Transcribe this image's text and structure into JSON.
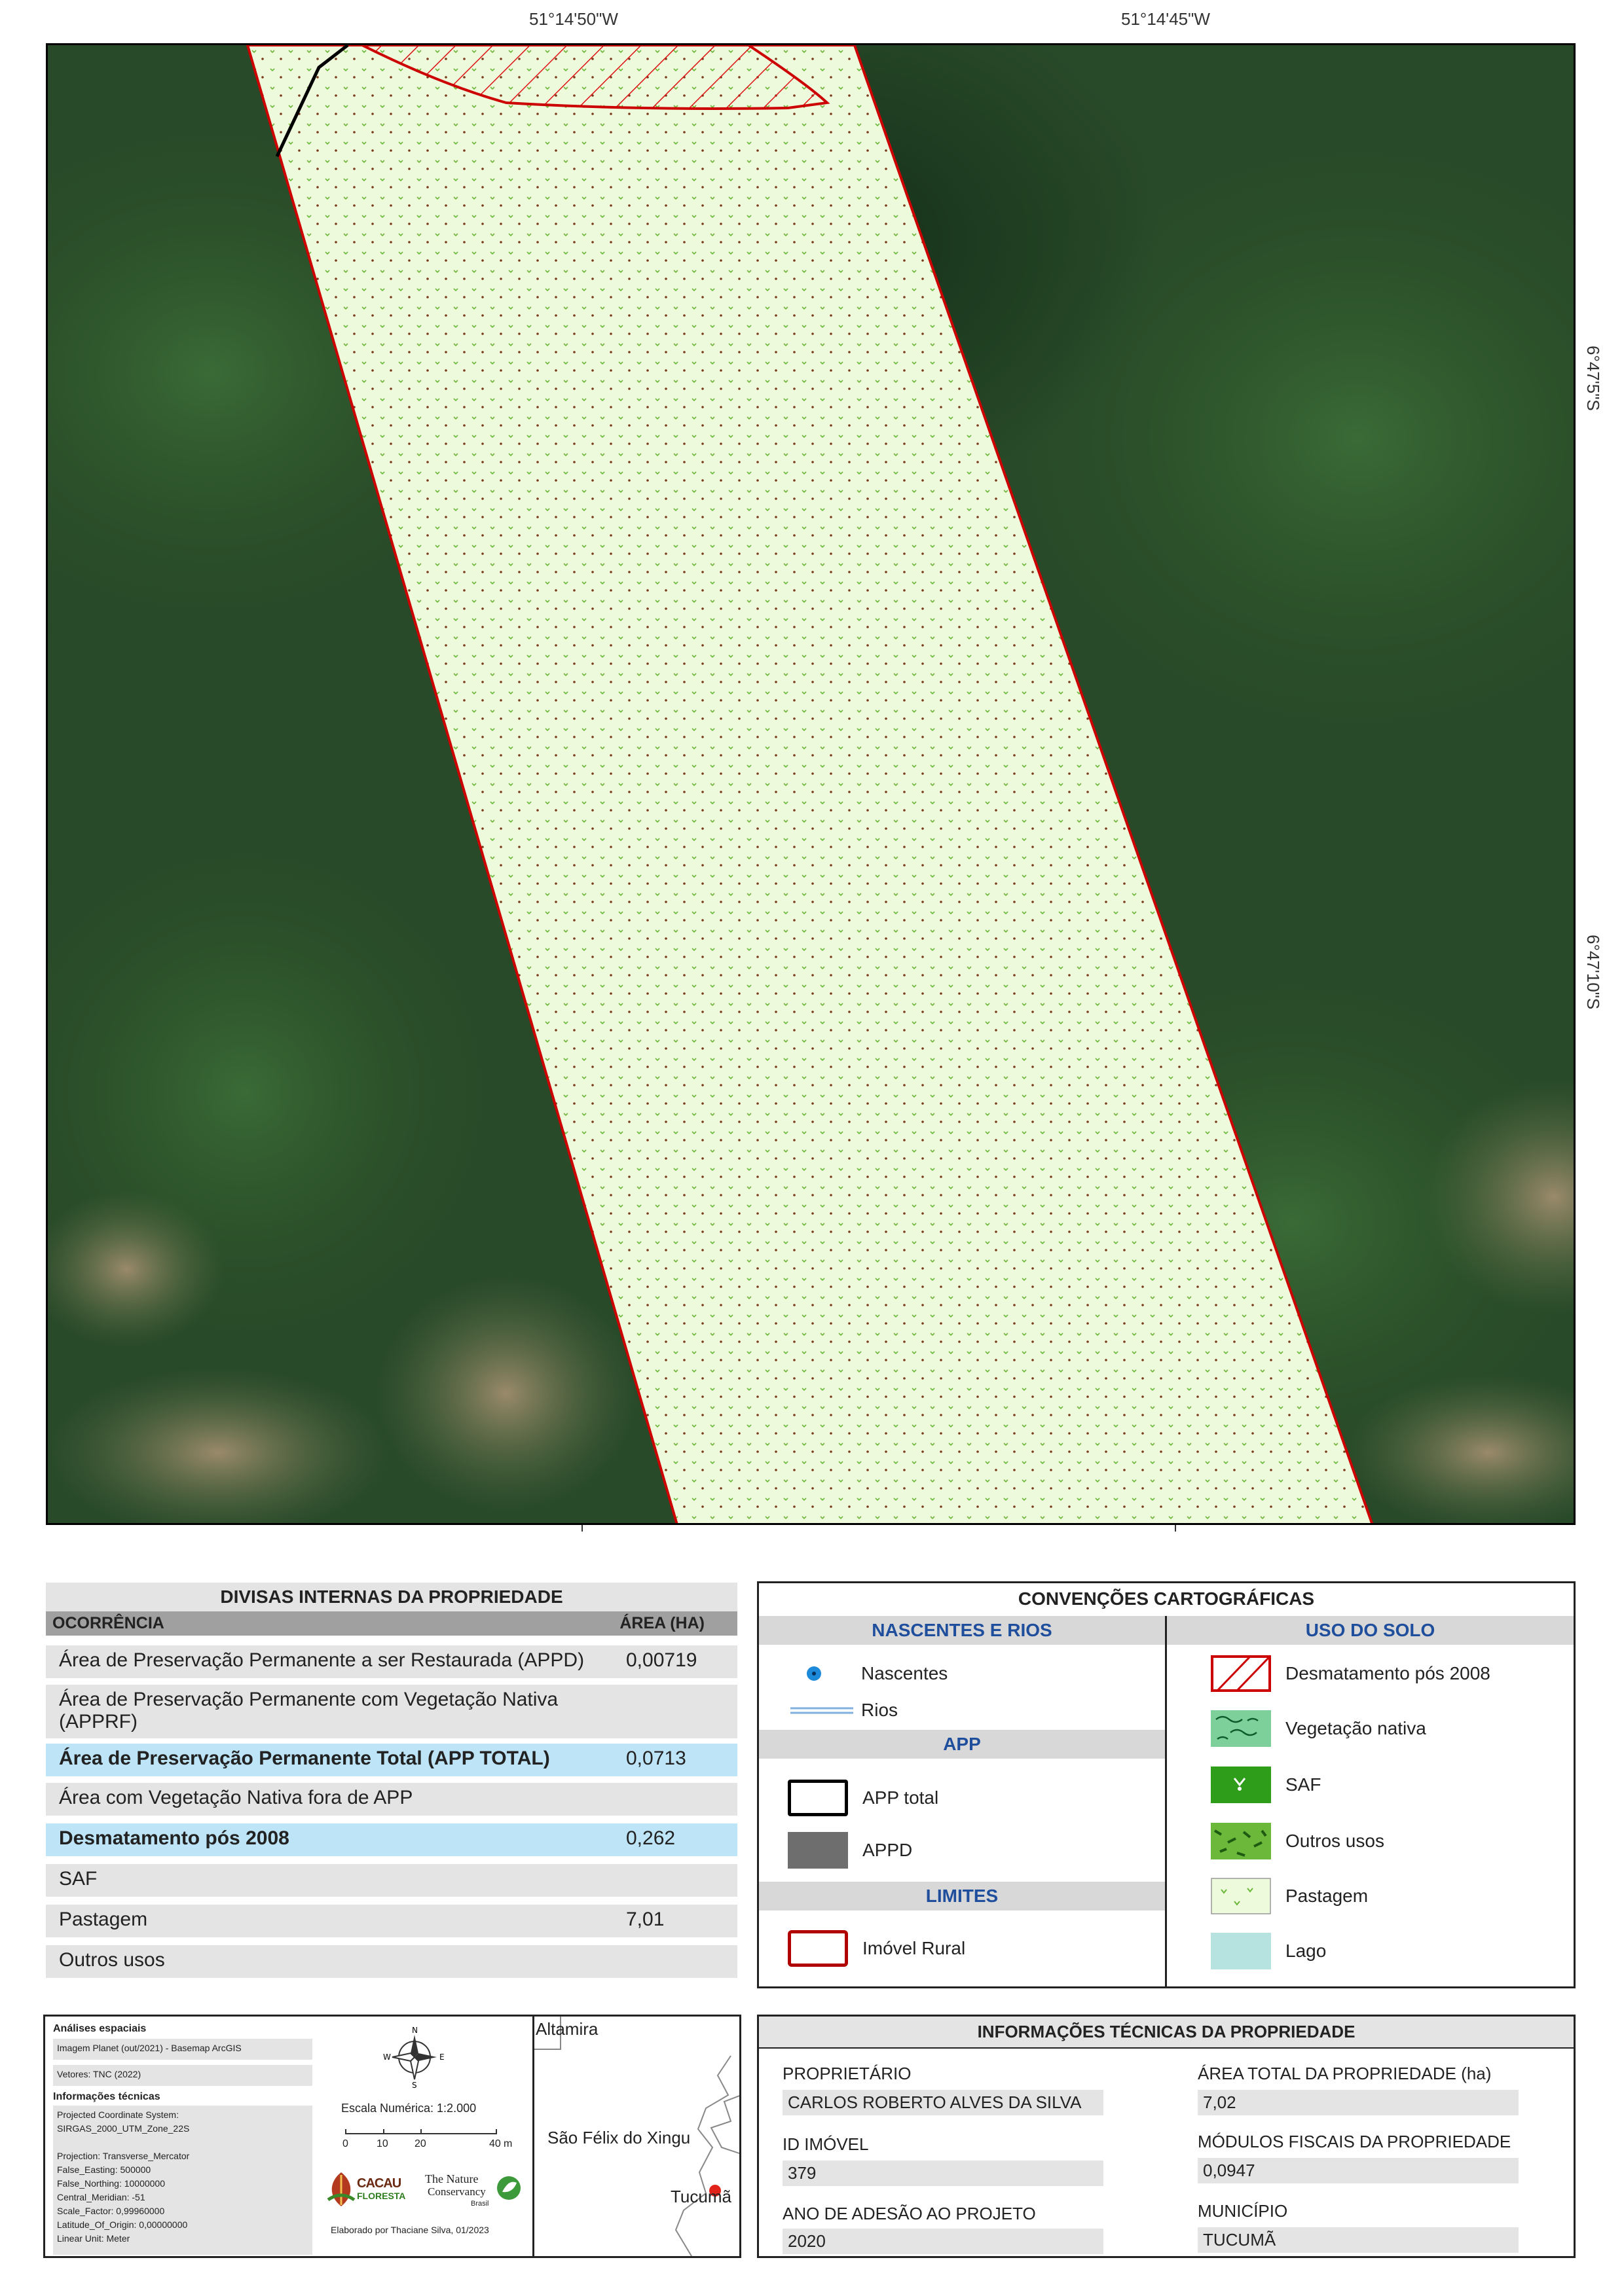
{
  "coordinates": {
    "top": [
      "51°14'50\"W",
      "51°14'45\"W"
    ],
    "right": [
      "6°47'5\"S",
      "6°47'10\"S"
    ]
  },
  "internal_divisions": {
    "title": "DIVISAS INTERNAS DA PROPRIEDADE",
    "col_occurrence": "OCORRÊNCIA",
    "col_area": "ÁREA (HA)",
    "rows": [
      {
        "label": "Área de Preservação Permanente a ser Restaurada (APPD)",
        "value": "0,00719"
      },
      {
        "label": "Área de Preservação Permanente com Vegetação Nativa (APPRF)",
        "value": ""
      },
      {
        "label": "Área de Preservação Permanente Total (APP TOTAL)",
        "value": "0,0713"
      },
      {
        "label": "Área com Vegetação Nativa fora de APP",
        "value": ""
      },
      {
        "label": "Desmatamento pós 2008",
        "value": "0,262"
      },
      {
        "label": "SAF",
        "value": ""
      },
      {
        "label": "Pastagem",
        "value": "7,01"
      },
      {
        "label": "Outros usos",
        "value": ""
      }
    ]
  },
  "legend": {
    "title": "CONVENÇÕES CARTOGRÁFICAS",
    "springs_rivers": {
      "heading": "NASCENTES E RIOS",
      "items": [
        "Nascentes",
        "Rios"
      ]
    },
    "app": {
      "heading": "APP",
      "items": [
        "APP total",
        "APPD"
      ]
    },
    "limits": {
      "heading": "LIMITES",
      "items": [
        "Imóvel Rural"
      ]
    },
    "land_use": {
      "heading": "USO DO SOLO",
      "items": [
        "Desmatamento pós 2008",
        "Vegetação nativa",
        "SAF",
        "Outros usos",
        "Pastagem",
        "Lago"
      ]
    },
    "colors": {
      "limit": "#cc0000",
      "appd": "#6e6e6e",
      "pasture": "#eefadc",
      "saf": "#2e9e1a",
      "native": "#7ed09a",
      "other": "#6cb83a",
      "lake": "#b6e2e0"
    }
  },
  "spatial": {
    "analysis_title": "Análises espaciais",
    "image_source": "Imagem Planet (out/2021) - Basemap ArcGIS",
    "vectors": "Vetores: TNC (2022)",
    "tech_title": "Informações técnicas",
    "tech_lines": [
      "Projected Coordinate System:",
      "SIRGAS_2000_UTM_Zone_22S",
      "",
      "Projection: Transverse_Mercator",
      "False_Easting: 500000",
      "False_Northing: 10000000",
      "Central_Meridian: -51",
      "Scale_Factor: 0,99960000",
      "Latitude_Of_Origin: 0,00000000",
      "Linear Unit: Meter"
    ],
    "scale_text": "Escala Numérica: 1:2.000",
    "scale_ticks": [
      "0",
      "10",
      "20",
      "40"
    ],
    "scale_unit": "m",
    "compass": [
      "N",
      "S",
      "W",
      "E"
    ],
    "logo_cacau": [
      "CACAU",
      "FLORESTA"
    ],
    "logo_tnc": [
      "The Nature",
      "Conservancy",
      "Brasil"
    ],
    "author": "Elaborado por Thaciane Silva, 01/2023"
  },
  "locator": {
    "places": [
      "Altamira",
      "São Félix do Xingu",
      "Tucumã"
    ]
  },
  "property_info": {
    "title": "INFORMAÇÕES TÉCNICAS DA PROPRIEDADE",
    "owner_label": "PROPRIETÁRIO",
    "owner": "CARLOS ROBERTO ALVES DA SILVA",
    "id_label": "ID IMÓVEL",
    "id": "379",
    "year_label": "ANO DE ADESÃO AO PROJETO",
    "year": "2020",
    "area_label": "ÁREA TOTAL DA PROPRIEDADE (ha)",
    "area": "7,02",
    "modules_label": "MÓDULOS FISCAIS DA PROPRIEDADE",
    "modules": "0,0947",
    "city_label": "MUNICÍPIO",
    "city": "TUCUMÃ"
  }
}
